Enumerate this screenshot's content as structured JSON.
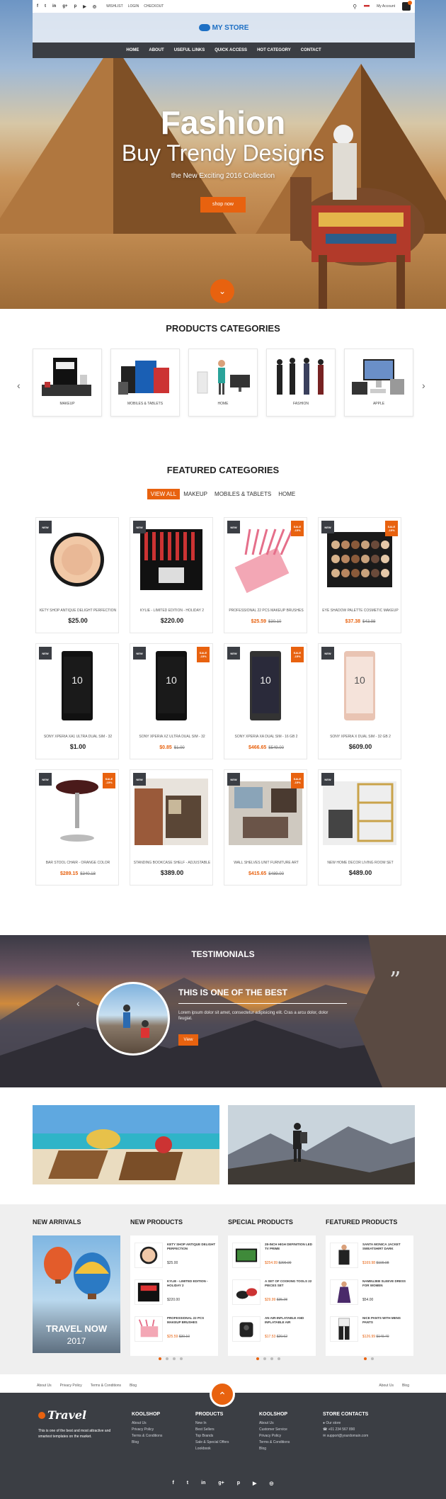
{
  "topbar": {
    "social": [
      "f",
      "t",
      "in",
      "g+",
      "p",
      "▶",
      "◎"
    ],
    "links": [
      "WISHLIST",
      "LOGIN",
      "CHECKOUT"
    ],
    "account": "My Account"
  },
  "logo": "MY STORE",
  "nav": [
    "HOME",
    "ABOUT",
    "USEFUL LINKS",
    "QUICK ACCESS",
    "HOT CATEGORY",
    "CONTACT"
  ],
  "hero": {
    "title": "Fashion",
    "subtitle": "Buy Trendy Designs",
    "tagline": "the New Exciting 2016 Collection",
    "cta": "shop now"
  },
  "categories_section": {
    "title": "PRODUCTS CATEGORIES",
    "items": [
      "MAKEUP",
      "MOBILES & TABLETS",
      "HOME",
      "FASHION",
      "APPLE"
    ]
  },
  "featured": {
    "title": "FEATURED CATEGORIES",
    "tabs": [
      "VIEW ALL",
      "MAKEUP",
      "MOBILES & TABLETS",
      "HOME"
    ],
    "new_label": "NEW",
    "sale_label": "SALE",
    "products": [
      {
        "name": "KETY SHOP ANTIQUE DELIGHT PERFECTION",
        "price": "$25.00",
        "old": "",
        "badge": "new",
        "discount": ""
      },
      {
        "name": "KYLIE - LIMITED EDITION - HOLIDAY 2",
        "price": "$220.00",
        "old": "",
        "badge": "new",
        "discount": ""
      },
      {
        "name": "PROFESSIONAL 22 PCS MAKEUP BRUSHES",
        "price": "$25.59",
        "old": "$30.10",
        "badge": "both",
        "discount": "-15%"
      },
      {
        "name": "EYE SHADOW PALETTE COSMETIC MAKEUP",
        "price": "$37.38",
        "old": "$43.98",
        "badge": "both",
        "discount": "-15%"
      },
      {
        "name": "SONY XPERIA XA1 ULTRA DUAL SIM - 32",
        "price": "$1.00",
        "old": "",
        "badge": "new",
        "discount": ""
      },
      {
        "name": "SONY XPERIA XZ ULTRA DUAL SIM - 32",
        "price": "$0.85",
        "old": "$1.00",
        "badge": "both",
        "discount": "-15%"
      },
      {
        "name": "SONY XPERIA XA DUAL SIM - 16 GB 2",
        "price": "$466.65",
        "old": "$549.00",
        "badge": "both",
        "discount": "-15%"
      },
      {
        "name": "SONY XPERIA X DUAL SIM - 32 GB 2",
        "price": "$609.00",
        "old": "",
        "badge": "new",
        "discount": ""
      },
      {
        "name": "BAR STOOL CHAIR - ORANGE COLOR",
        "price": "$289.15",
        "old": "$340.18",
        "badge": "both",
        "discount": "-15%"
      },
      {
        "name": "STANDING BOOKCASE SHELF - ADJUSTABLE",
        "price": "$389.00",
        "old": "",
        "badge": "new",
        "discount": ""
      },
      {
        "name": "WALL SHELVES UNIT FURNITURE ART",
        "price": "$415.65",
        "old": "$489.00",
        "badge": "both",
        "discount": "-15%"
      },
      {
        "name": "NEW HOME DECOR LIVING ROOM SET",
        "price": "$489.00",
        "old": "",
        "badge": "new",
        "discount": ""
      }
    ]
  },
  "testimonials": {
    "title": "TESTIMONIALS",
    "heading": "THIS IS ONE OF THE BEST",
    "text": "Lorem ipsum dolor sit amet, consectetur adipisicing elit. Cras a arcu dolor, dolor feugiat.",
    "cta": "View"
  },
  "arrivals": {
    "col1": "NEW ARRIVALS",
    "col2": "NEW PRODUCTS",
    "col3": "SPECIAL PRODUCTS",
    "col4": "FEATURED PRODUCTS",
    "banner": "TRAVEL NOW",
    "banner_year": "2017",
    "new_products": [
      {
        "name": "KETY SHOP ANTIQUE DELIGHT PERFECTION",
        "price": "$25.00",
        "old": ""
      },
      {
        "name": "KYLIE - LIMITED EDITION - HOLIDAY 2",
        "price": "$220.00",
        "old": ""
      },
      {
        "name": "PROFESSIONAL 22 PCS MAKEUP BRUSHES",
        "price": "$25.59",
        "old": "$30.10"
      }
    ],
    "special_products": [
      {
        "name": "28-INCH HIGH DEFINITION LED TV PRIME",
        "price": "$254.99",
        "old": "$299.99"
      },
      {
        "name": "A SET OF COOKING TOOLS 22 PIECES SET",
        "price": "$29.99",
        "old": "$35.28"
      },
      {
        "name": "AN AIR-INFLATABLE AND INFLATABLE AIR",
        "price": "$17.53",
        "old": "$20.62"
      }
    ],
    "featured_products": [
      {
        "name": "SANTA MONICA JACKET SWEATSHIRT DARK",
        "price": "$169.98",
        "old": "$199.98"
      },
      {
        "name": "NAMEUJEB SLEEVE DRESS FOR WOMEN",
        "price": "$54.00",
        "old": ""
      },
      {
        "name": "NICE PANTS WITH MENS PANTS",
        "price": "$126.99",
        "old": "$149.40"
      }
    ]
  },
  "bottom_links": {
    "left": [
      "About Us",
      "Privacy Policy",
      "Terms & Conditions",
      "Blog"
    ],
    "right": [
      "About Us",
      "Blog"
    ]
  },
  "footer": {
    "brand": "Travel",
    "about": "This is one of the best and most attractive and smartest templates on the market.",
    "cols": [
      {
        "title": "KOOLSHOP",
        "links": [
          "About Us",
          "Privacy Policy",
          "Terms & Conditions",
          "Blog"
        ]
      },
      {
        "title": "PRODUCTS",
        "links": [
          "New In",
          "Best Sellers",
          "Top Brands",
          "Sale & Special Offers",
          "Lookbook"
        ]
      },
      {
        "title": "KOOLSHOP",
        "links": [
          "About Us",
          "Customer Service",
          "Privacy Policy",
          "Terms & Conditions",
          "Blog"
        ]
      },
      {
        "title": "STORE CONTACTS",
        "links": [
          "Our store",
          "+01 234 567 890",
          "support@yourdomain.com"
        ]
      }
    ],
    "social": [
      "f",
      "t",
      "in",
      "g+",
      "p",
      "▶",
      "◎"
    ]
  },
  "colors": {
    "accent": "#e8620f",
    "dark": "#3b3e44",
    "logo": "#1d6fc4"
  }
}
